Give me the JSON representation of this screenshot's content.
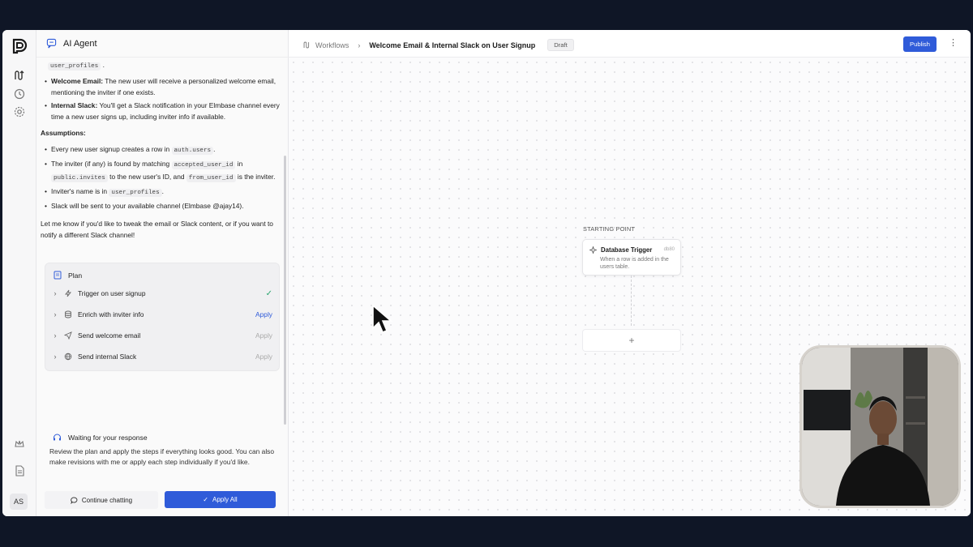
{
  "app": {
    "brand_icon": "brand-logo"
  },
  "rail": {
    "avatar_initials": "AS"
  },
  "panel": {
    "title": "AI Agent",
    "msg_top_code": "user_profiles",
    "msg_top_dot": ".",
    "bullets_top": [
      {
        "bold": "Welcome Email:",
        "text": " The new user will receive a personalized welcome email, mentioning the inviter if one exists."
      },
      {
        "bold": "Internal Slack:",
        "text": " You'll get a Slack notification in your Elmbase channel every time a new user signs up, including inviter info if available."
      }
    ],
    "assumptions_title": "Assumptions:",
    "assumptions": {
      "a1_pre": "Every new user signup creates a row in ",
      "a1_code": "auth.users",
      "a1_post": ".",
      "a2_pre": "The inviter (if any) is found by matching ",
      "a2_code1": "accepted_user_id",
      "a2_mid1": " in ",
      "a2_code2": "public.invites",
      "a2_mid2": " to the new user's ID, and ",
      "a2_code3": "from_user_id",
      "a2_post": " is the inviter.",
      "a3_pre": "Inviter's name is in ",
      "a3_code": "user_profiles",
      "a3_post": ".",
      "a4": "Slack will be sent to your available channel (Elmbase @ajay14)."
    },
    "followup": "Let me know if you'd like to tweak the email or Slack content, or if you want to notify a different Slack channel!",
    "plan": {
      "title": "Plan",
      "steps": [
        {
          "label": "Trigger on user signup",
          "action": ""
        },
        {
          "label": "Enrich with inviter info",
          "action": "Apply"
        },
        {
          "label": "Send welcome email",
          "action": "Apply"
        },
        {
          "label": "Send internal Slack",
          "action": "Apply"
        }
      ]
    },
    "waiting": {
      "title": "Waiting for your response",
      "body": "Review the plan and apply the steps if everything looks good. You can also make revisions with me or apply each step individually if you'd like.",
      "continue_label": "Continue chatting",
      "apply_all_label": "Apply All"
    }
  },
  "topbar": {
    "crumb_root": "Workflows",
    "crumb_sep": "›",
    "title": "Welcome Email & Internal Slack on User Signup",
    "status": "Draft",
    "publish_label": "Publish",
    "more_label": "⋮"
  },
  "canvas": {
    "starting_point": "STARTING POINT",
    "node": {
      "title": "Database Trigger",
      "id": "db80",
      "desc": "When a row is added in the users table."
    },
    "add_label": "+"
  },
  "colors": {
    "accent": "#2f5bd9",
    "success": "#2aa56f",
    "frame_bg": "#0f1626"
  }
}
